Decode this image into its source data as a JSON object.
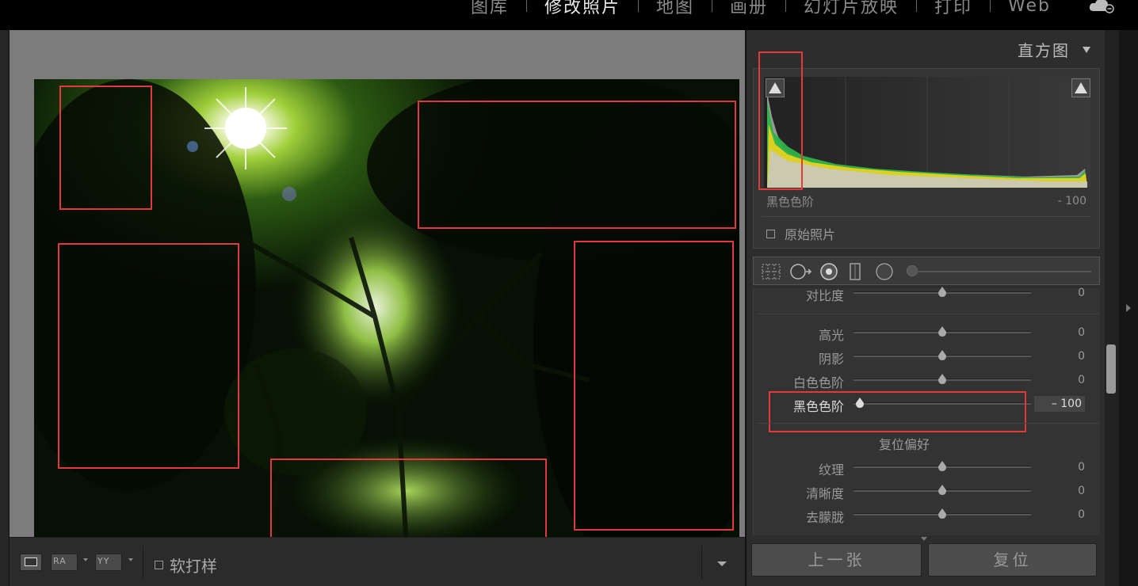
{
  "modules": [
    "图库",
    "修改照片",
    "地图",
    "画册",
    "幻灯片放映",
    "打印",
    "Web"
  ],
  "active_module": "修改照片",
  "right_panel": {
    "title": "直方图",
    "histogram_caption": "黑色色阶",
    "histogram_value": "- 100",
    "original_photo_label": "原始照片"
  },
  "sliders": [
    {
      "label": "对比度",
      "value": "0",
      "position": 0.5
    },
    {
      "label": "高光",
      "value": "0",
      "position": 0.5
    },
    {
      "label": "阴影",
      "value": "0",
      "position": 0.5
    },
    {
      "label": "白色色阶",
      "value": "0",
      "position": 0.5
    },
    {
      "label": "黑色色阶",
      "value": "– 100",
      "position": 0.0
    },
    {
      "label": "纹理",
      "value": "0",
      "position": 0.5
    },
    {
      "label": "清晰度",
      "value": "0",
      "position": 0.5
    },
    {
      "label": "去朦胧",
      "value": "0",
      "position": 0.5
    }
  ],
  "reset_preferences": "复位偏好",
  "toolbar": {
    "view_ra": "RA",
    "view_yy": "YY",
    "soft_proof": "软打样"
  },
  "buttons": {
    "previous": "上一张",
    "reset": "复位"
  },
  "colors": {
    "highlight_box": "#e03a3a",
    "histogram_green": "#2fb34a",
    "histogram_yellow": "#e6d21e"
  }
}
